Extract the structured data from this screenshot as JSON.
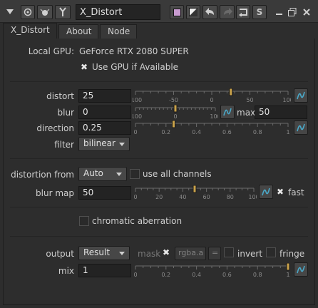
{
  "window": {
    "title": "X_Distort",
    "icons": [
      "collapse-arrow-icon",
      "settings-circle-icon",
      "bug-icon",
      "pin-icon",
      "color-swatch-icon",
      "half-box-icon",
      "undo-icon",
      "redo-icon",
      "revert-icon",
      "s-icon",
      "minimize-icon",
      "float-icon",
      "close-icon"
    ],
    "s_label": "S"
  },
  "tabs": [
    {
      "label": "X_Distort",
      "active": true
    },
    {
      "label": "About",
      "active": false
    },
    {
      "label": "Node",
      "active": false
    }
  ],
  "gpu": {
    "label": "Local GPU:",
    "device": "GeForce RTX 2080 SUPER",
    "use_gpu_label": "Use GPU if Available",
    "use_gpu_checked": true
  },
  "distort": {
    "label": "distort",
    "value": "25",
    "ticks": [
      "-100",
      "-50",
      "0",
      "50",
      "100"
    ],
    "fraction": 0.625
  },
  "blur": {
    "label": "blur",
    "value": "0",
    "ticks": [
      "-100",
      "0",
      "100"
    ],
    "fraction": 0.5,
    "max_label": "max",
    "max_value": "50"
  },
  "direction": {
    "label": "direction",
    "value": "0.25",
    "ticks": [
      "0",
      "0.2",
      "0.4",
      "0.6",
      "0.8",
      "1"
    ],
    "fraction": 0.25
  },
  "filter": {
    "label": "filter",
    "value": "bilinear"
  },
  "distortion_from": {
    "label": "distortion from",
    "value": "Auto",
    "use_all_channels_label": "use all channels",
    "use_all_channels_checked": false
  },
  "blur_map": {
    "label": "blur map",
    "value": "50",
    "ticks": [
      "0",
      "20",
      "40",
      "60",
      "80",
      "100"
    ],
    "fraction": 0.5,
    "fast_label": "fast",
    "fast_checked": true
  },
  "chromatic": {
    "label": "chromatic aberration",
    "checked": false
  },
  "output": {
    "label": "output",
    "value": "Result",
    "mask_label": "mask",
    "mask_checked": true,
    "channel_value": "rgba.a",
    "equals_label": "=",
    "invert_label": "invert",
    "invert_checked": false,
    "fringe_label": "fringe",
    "fringe_checked": false
  },
  "mix": {
    "label": "mix",
    "value": "1",
    "ticks": [
      "0",
      "0.2",
      "0.4",
      "0.6",
      "0.8",
      "1"
    ],
    "fraction": 1.0
  }
}
